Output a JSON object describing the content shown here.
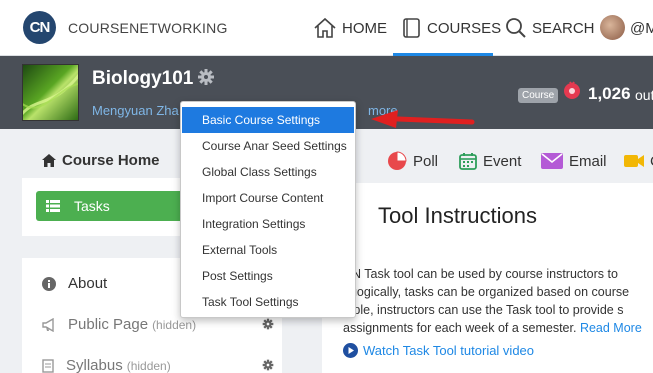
{
  "topnav": {
    "logo": "CN",
    "brand": "COURSENETWORKING",
    "home_label": "HOME",
    "courses_label": "COURSES",
    "search_label": "SEARCH",
    "user_label": "@M"
  },
  "course": {
    "title": "Biology101",
    "instructor": "Mengyuan Zha",
    "instructor_more": "more",
    "badge": "Course",
    "points": "1,026",
    "points_suffix": "out"
  },
  "sidebar": {
    "course_home": "Course Home",
    "tasks": "Tasks",
    "items": [
      {
        "label": "About",
        "hidden": ""
      },
      {
        "label": "Public Page",
        "hidden": "(hidden)"
      },
      {
        "label": "Syllabus",
        "hidden": "(hidden)"
      }
    ]
  },
  "tools": {
    "poll": "Poll",
    "event": "Event",
    "email": "Email",
    "video": "C"
  },
  "main": {
    "title": "Tool Instructions",
    "lines": [
      "CN Task tool can be used by course instructors to",
      "agogically, tasks can be organized based on course",
      "mple, instructors can use the Task tool to provide s",
      "assignments for each week of a semester."
    ],
    "read_more": "Read More",
    "video_link": "Watch Task Tool tutorial video"
  },
  "dropdown": {
    "items": [
      "Basic Course Settings",
      "Course Anar Seed Settings",
      "Global Class Settings",
      "Import Course Content",
      "Integration Settings",
      "External Tools",
      "Post Settings",
      "Task Tool Settings"
    ],
    "active_index": 0
  },
  "colors": {
    "accent": "#1e7ae0",
    "tasks_green": "#4caf50",
    "banner": "#4a4f57",
    "arrow": "#e02020"
  }
}
